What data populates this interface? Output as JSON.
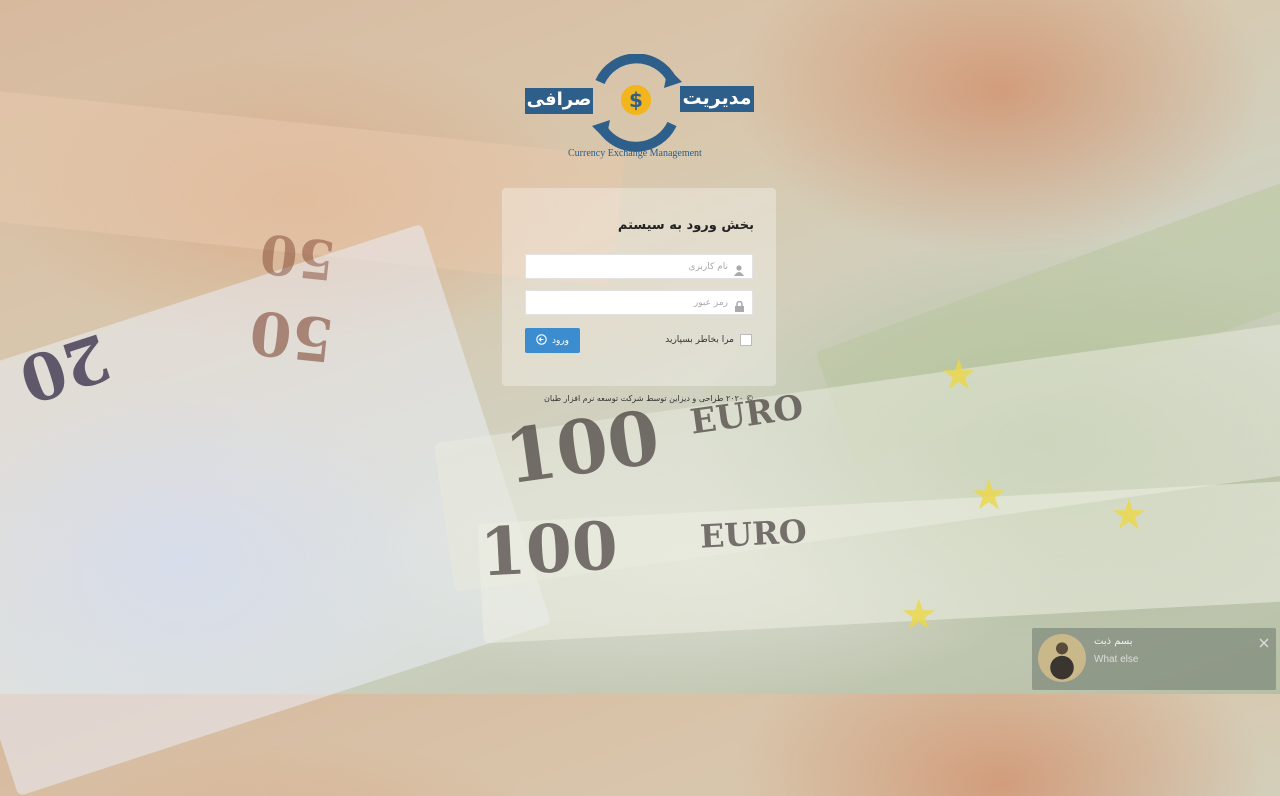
{
  "logo": {
    "title_line1": "مدیریت",
    "title_line2": "صرافی",
    "subtitle": "Currency Exchange Management"
  },
  "login": {
    "title": "بخش ورود به سیستم",
    "username_placeholder": "نام کاربری",
    "password_placeholder": "رمز عبور",
    "remember_label": "مرا بخاطر بسپارید",
    "submit_label": "ورود"
  },
  "footer": {
    "text": "© ۲۰۲۰ طراحی و دیزاین توسط شرکت توسعه نرم افزار طبان"
  },
  "notification": {
    "title": "بسم ذبت",
    "message": "What else"
  },
  "colors": {
    "primary_button": "#3c8dcf",
    "logo_blue": "#2e5f8a",
    "logo_gold": "#f2b51b"
  }
}
